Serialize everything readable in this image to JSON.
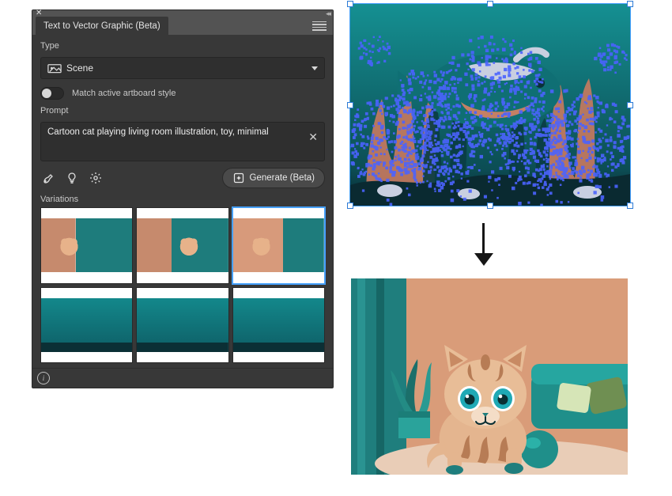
{
  "panel": {
    "title": "Text to Vector Graphic (Beta)",
    "type_label": "Type",
    "type_value": "Scene",
    "type_icon": "scene-icon",
    "match_artboard_label": "Match active artboard style",
    "match_artboard_on": false,
    "prompt_label": "Prompt",
    "prompt_value": "Cartoon cat playing living room illustration, toy, minimal",
    "actions": {
      "style_picker_icon": "style-picker-icon",
      "ideas_icon": "lightbulb-icon",
      "settings_icon": "gear-icon",
      "generate_label": "Generate (Beta)",
      "generate_icon": "sparkle-generate-icon"
    },
    "variations_label": "Variations",
    "variations": [
      {
        "kind": "room",
        "selected": false
      },
      {
        "kind": "room v2",
        "selected": false
      },
      {
        "kind": "room v3",
        "selected": true
      },
      {
        "kind": "aqua",
        "selected": false
      },
      {
        "kind": "aqua v2",
        "selected": false
      },
      {
        "kind": "aqua v3",
        "selected": false
      }
    ],
    "info_icon": "info-icon"
  },
  "canvas": {
    "top_art": "underwater-fish-coral-selected",
    "bottom_art": "cartoon-cat-living-room",
    "arrow": "down-arrow"
  }
}
